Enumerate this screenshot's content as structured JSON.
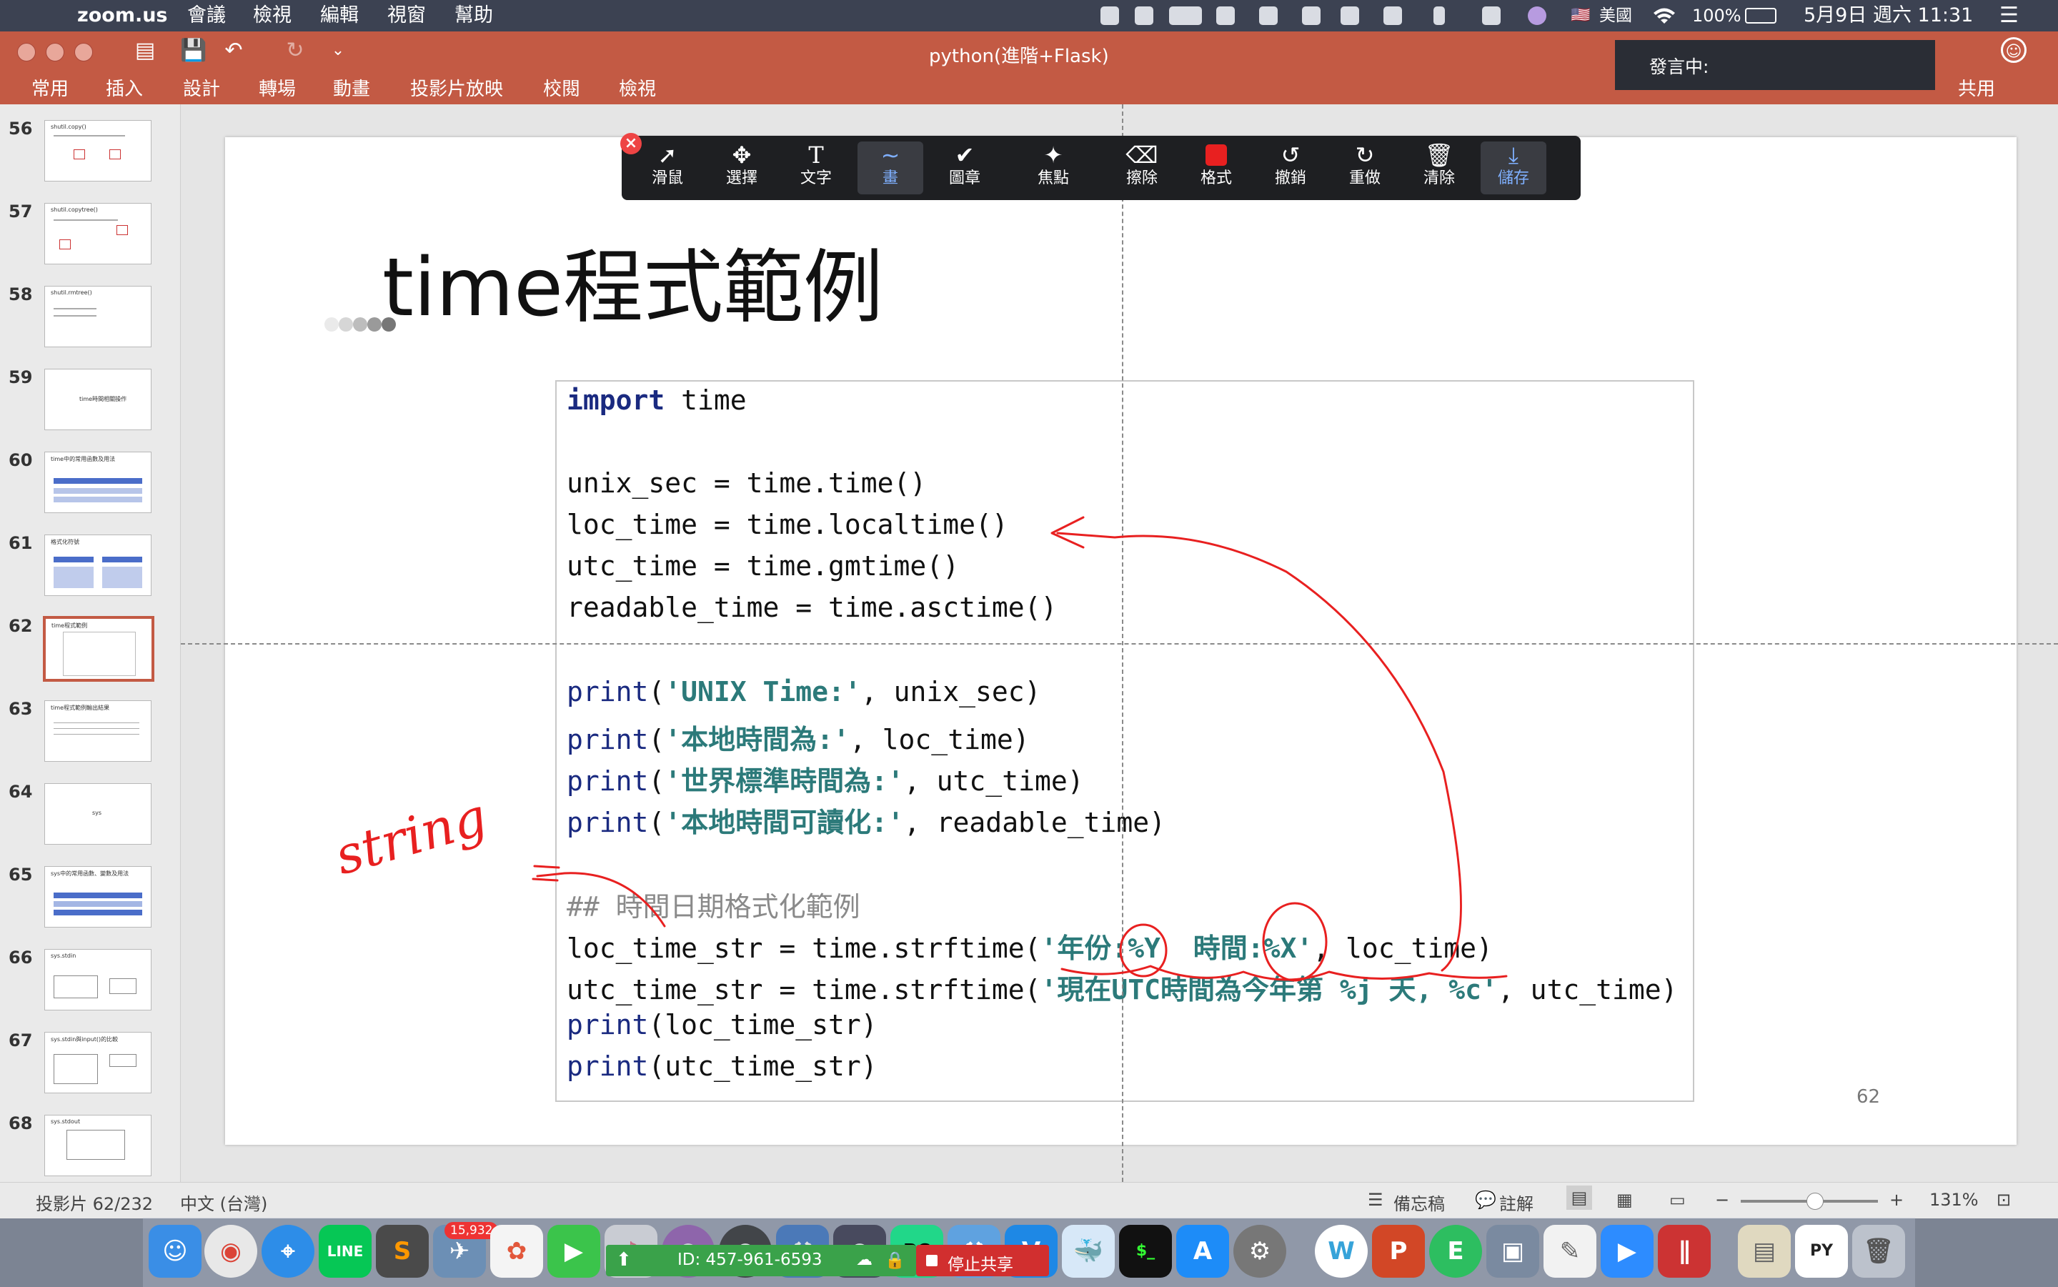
{
  "menubar": {
    "app_name": "zoom.us",
    "items": [
      "會議",
      "檢視",
      "編輯",
      "視窗",
      "幫助"
    ],
    "input_source": "美國",
    "battery": "100%",
    "datetime": "5月9日 週六 11:31"
  },
  "powerpoint": {
    "doc_title": "python(進階+Flask)",
    "ribbon_tabs": [
      "常用",
      "插入",
      "設計",
      "轉場",
      "動畫",
      "投影片放映",
      "校閱",
      "檢視"
    ],
    "share_label": "共用"
  },
  "speaking": {
    "label": "發言中:"
  },
  "thumbnails": [
    {
      "num": "56",
      "title": "shutil.copy()"
    },
    {
      "num": "57",
      "title": "shutil.copytree()"
    },
    {
      "num": "58",
      "title": "shutil.rmtree()"
    },
    {
      "num": "59",
      "title": "time時間相關操作"
    },
    {
      "num": "60",
      "title": "time中的常用函數及用法"
    },
    {
      "num": "61",
      "title": "格式化符號"
    },
    {
      "num": "62",
      "title": "time程式範例"
    },
    {
      "num": "63",
      "title": "time程式範例輸出結果"
    },
    {
      "num": "64",
      "title": "sys"
    },
    {
      "num": "65",
      "title": "sys中的常用函數、變數及用法"
    },
    {
      "num": "66",
      "title": "sys.stdin"
    },
    {
      "num": "67",
      "title": "sys.stdin與input()的比較"
    },
    {
      "num": "68",
      "title": "sys.stdout"
    }
  ],
  "slide": {
    "title": "time程式範例",
    "page_number": "62",
    "code": {
      "l1_kw": "import",
      "l1_rest": " time",
      "l2": "unix_sec = time.time()",
      "l3": "loc_time = time.localtime()",
      "l4": "utc_time = time.gmtime()",
      "l5": "readable_time = time.asctime()",
      "l6_fn": "print",
      "l6_a": "(",
      "l6_str": "'UNIX Time:'",
      "l6_b": ", unix_sec)",
      "l7_fn": "print",
      "l7_a": "(",
      "l7_str": "'本地時間為:'",
      "l7_b": ", loc_time)",
      "l8_fn": "print",
      "l8_a": "(",
      "l8_str": "'世界標準時間為:'",
      "l8_b": ", utc_time)",
      "l9_fn": "print",
      "l9_a": "(",
      "l9_str": "'本地時間可讀化:'",
      "l9_b": ", readable_time)",
      "l10": "## 時間日期格式化範例",
      "l11_a": "loc_time_str = time.strftime(",
      "l11_str": "'年份:%Y  時間:%X'",
      "l11_b": ", loc_time)",
      "l12_a": "utc_time_str = time.strftime(",
      "l12_str": "'現在UTC時間為今年第 %j 天, %c'",
      "l12_b": ", utc_time)",
      "l13_fn": "print",
      "l13_b": "(loc_time_str)",
      "l14_fn": "print",
      "l14_b": "(utc_time_str)"
    },
    "handwriting": "string"
  },
  "annotation_toolbar": {
    "tools": [
      "滑鼠",
      "選擇",
      "文字",
      "畫",
      "圖章",
      "焦點",
      "擦除",
      "格式",
      "撤銷",
      "重做",
      "清除",
      "儲存"
    ],
    "active_tool": "畫",
    "pen_color": "#e82020"
  },
  "statusbar": {
    "slide_position": "投影片 62/232",
    "language": "中文 (台灣)",
    "notes_label": "備忘稿",
    "comments_label": "註解",
    "zoom": "131%"
  },
  "dock": {
    "badge": "15,932",
    "meeting_id": "ID: 457-961-6593",
    "stop_share": "停止共享"
  },
  "colors": {
    "ribbon": "#c35a44",
    "menubar": "#3c4252",
    "code_keyword": "#1a2a80",
    "code_string": "#2c7a7a",
    "ink": "#e82020"
  }
}
